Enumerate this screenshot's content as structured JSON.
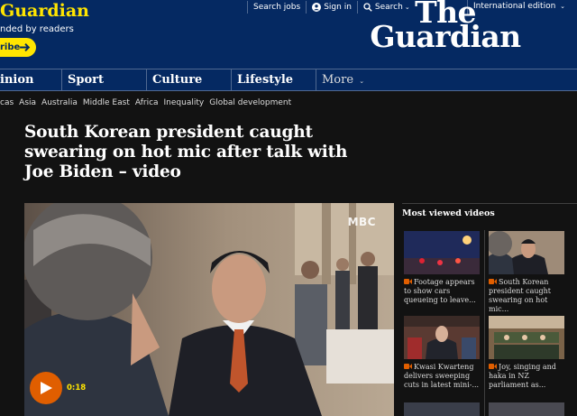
{
  "support": {
    "title": "Guardian",
    "subtitle": "nded by readers",
    "subscribe_label": "ribe"
  },
  "top_links": {
    "search_jobs": "Search jobs",
    "sign_in": "Sign in",
    "search": "Search",
    "edition": "International edition"
  },
  "logo": {
    "line1": "The",
    "line2": "Guardian"
  },
  "nav": {
    "items": [
      "inion",
      "Sport",
      "Culture",
      "Lifestyle"
    ],
    "more": "More"
  },
  "subnav": {
    "items": [
      "cas",
      "Asia",
      "Australia",
      "Middle East",
      "Africa",
      "Inequality",
      "Global development"
    ]
  },
  "article": {
    "headline": "South Korean president caught swearing on hot mic after talk with Joe Biden – video",
    "video_watermark": "MBC",
    "duration": "0:18"
  },
  "sidebar": {
    "title": "Most viewed videos",
    "items": [
      {
        "caption": "Footage appears to show cars queueing to leave..."
      },
      {
        "caption": "South Korean president caught swearing on hot mic..."
      },
      {
        "caption": "Kwasi Kwarteng delivers sweeping cuts in latest mini-..."
      },
      {
        "caption": "Joy, singing and haka in NZ parliament as..."
      }
    ]
  },
  "colors": {
    "brand_blue": "#052962",
    "accent_yellow": "#ffe500",
    "video_orange": "#e05e00",
    "background": "#121212"
  }
}
